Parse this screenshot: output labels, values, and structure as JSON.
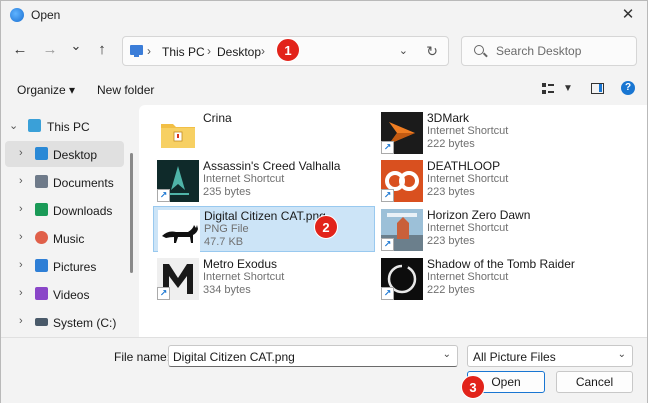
{
  "window": {
    "title": "Open",
    "close_glyph": "✕"
  },
  "nav": {
    "back": "←",
    "forward": "→",
    "recent": "⌄",
    "up": "↑",
    "breadcrumb": [
      "This PC",
      "Desktop"
    ],
    "search_placeholder": "Search Desktop"
  },
  "toolbar": {
    "organize_label": "Organize ▾",
    "new_folder_label": "New folder",
    "help_glyph": "?"
  },
  "sidebar": {
    "items": [
      {
        "label": "This PC",
        "icon": "computer-icon",
        "color": "#3aa0d8"
      },
      {
        "label": "Desktop",
        "icon": "desktop-icon",
        "color": "#2a89d6"
      },
      {
        "label": "Documents",
        "icon": "documents-icon",
        "color": "#6f7b8a"
      },
      {
        "label": "Downloads",
        "icon": "downloads-icon",
        "color": "#1a9a57"
      },
      {
        "label": "Music",
        "icon": "music-icon",
        "color": "#e0604a"
      },
      {
        "label": "Pictures",
        "icon": "pictures-icon",
        "color": "#2f7fd6"
      },
      {
        "label": "Videos",
        "icon": "videos-icon",
        "color": "#8a46c8"
      },
      {
        "label": "System (C:)",
        "icon": "drive-icon",
        "color": "#4a5a6a"
      }
    ]
  },
  "files": [
    {
      "name": "Crina",
      "type": "",
      "size": "",
      "kind": "folder"
    },
    {
      "name": "3DMark",
      "type": "Internet Shortcut",
      "size": "222 bytes",
      "kind": "shortcut"
    },
    {
      "name": "Assassin's Creed Valhalla",
      "type": "Internet Shortcut",
      "size": "235 bytes",
      "kind": "shortcut"
    },
    {
      "name": "DEATHLOOP",
      "type": "Internet Shortcut",
      "size": "223 bytes",
      "kind": "shortcut"
    },
    {
      "name": "Digital Citizen CAT.png",
      "type": "PNG File",
      "size": "47.7 KB",
      "kind": "image"
    },
    {
      "name": "Horizon Zero Dawn",
      "type": "Internet Shortcut",
      "size": "223 bytes",
      "kind": "shortcut"
    },
    {
      "name": "Metro Exodus",
      "type": "Internet Shortcut",
      "size": "334 bytes",
      "kind": "shortcut"
    },
    {
      "name": "Shadow of the Tomb Raider",
      "type": "Internet Shortcut",
      "size": "222 bytes",
      "kind": "shortcut"
    }
  ],
  "bottom": {
    "file_name_label": "File name:",
    "file_name_value": "Digital Citizen CAT.png",
    "filter_value": "All Picture Files",
    "open_label": "Open",
    "cancel_label": "Cancel"
  },
  "badges": [
    "1",
    "2",
    "3"
  ],
  "colors": {
    "accent": "#1976d2",
    "selection": "#cce4f7",
    "badge": "#e2231a"
  }
}
